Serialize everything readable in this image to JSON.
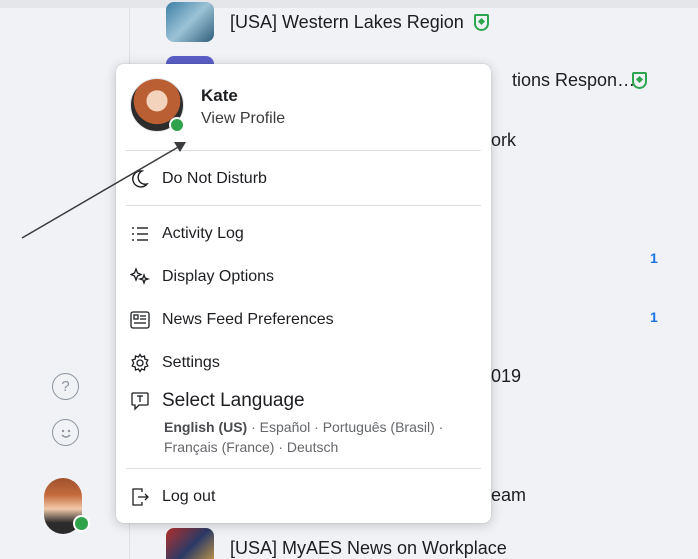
{
  "background": {
    "groups": [
      {
        "name": "[USA] Western Lakes Region",
        "official": true
      },
      {
        "name": "tions Respon…",
        "official": true
      },
      {
        "name": "ork",
        "official": false
      },
      {
        "name": "019",
        "official": false
      },
      {
        "name": "eam",
        "official": false
      },
      {
        "name": "[USA] MyAES News on Workplace",
        "official": false
      }
    ],
    "unread_counts": [
      "1",
      "1"
    ],
    "rail_icons": [
      "help-circle-icon",
      "smiley-icon"
    ]
  },
  "profile_menu": {
    "user_name": "Kate",
    "view_profile_label": "View Profile",
    "status": "online",
    "items": [
      {
        "label": "Do Not Disturb",
        "icon": "moon-icon"
      },
      {
        "label": "Activity Log",
        "icon": "list-icon"
      },
      {
        "label": "Display Options",
        "icon": "sparkle-icon"
      },
      {
        "label": "News Feed Preferences",
        "icon": "feed-icon"
      },
      {
        "label": "Settings",
        "icon": "gear-icon"
      },
      {
        "label": "Log out",
        "icon": "logout-icon"
      }
    ],
    "language": {
      "title": "Select Language",
      "current": "English (US)",
      "others": "· Español · Português (Brasil) · Français (France) · Deutsch"
    }
  },
  "colors": {
    "online_green": "#31a24c",
    "official_badge_green": "#2da44e",
    "count_blue": "#1b74e4"
  }
}
